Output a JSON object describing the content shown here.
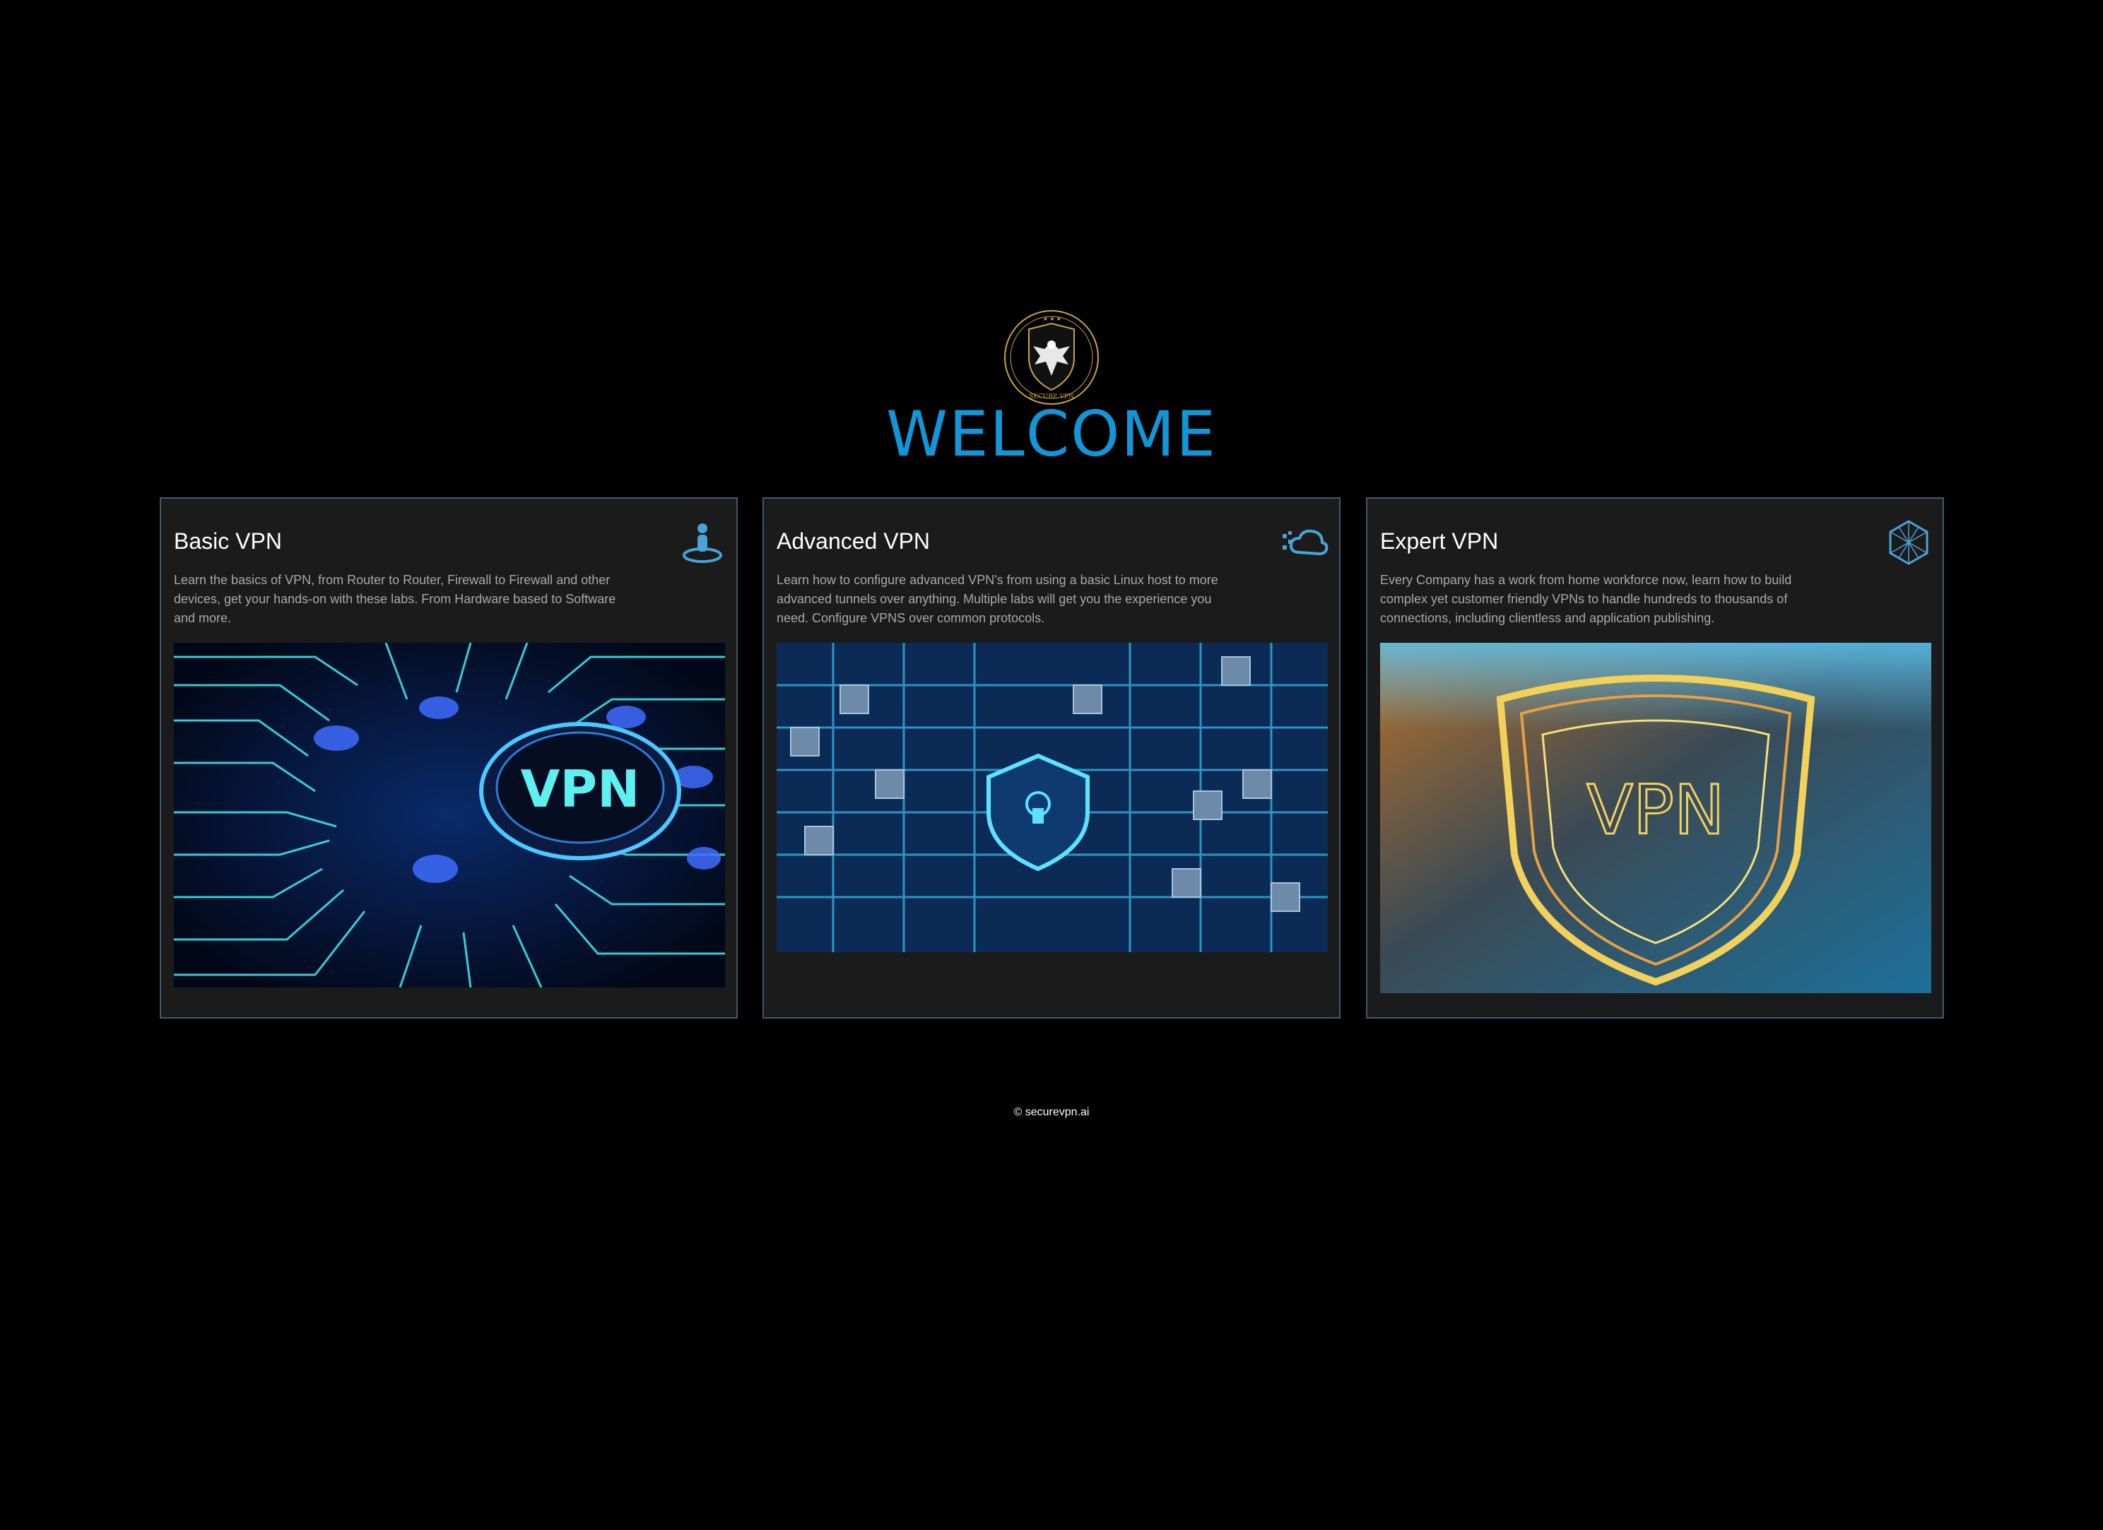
{
  "logo": {
    "brand_text": "SECURE VPN",
    "accent": "#c9a44a"
  },
  "heading": {
    "title": "WELCOME",
    "color": "#1296d8"
  },
  "cards": [
    {
      "title": "Basic VPN",
      "description": "Learn the basics of VPN, from Router to Router, Firewall to Firewall and other devices, get your hands-on with these labs. From Hardware based to Software and more.",
      "icon": "user-pin-icon",
      "image_text": "VPN"
    },
    {
      "title": "Advanced VPN",
      "description": "Learn how to configure advanced VPN's from using a basic Linux host to more advanced tunnels over anything. Multiple labs will get you the experience you need. Configure VPNS over common protocols.",
      "icon": "cloud-icon",
      "image_text": ""
    },
    {
      "title": "Expert VPN",
      "description": "Every Company has a work from home workforce now, learn how to build complex yet customer friendly VPNs to handle hundreds to thousands of connections, including clientless and application publishing.",
      "icon": "hexagon-network-icon",
      "image_text": "VPN"
    }
  ],
  "footer": {
    "text": "© securevpn.ai"
  },
  "colors": {
    "card_bg": "#1b1b1b",
    "card_border": "#3d5a72",
    "icon": "#4aa3d8"
  }
}
